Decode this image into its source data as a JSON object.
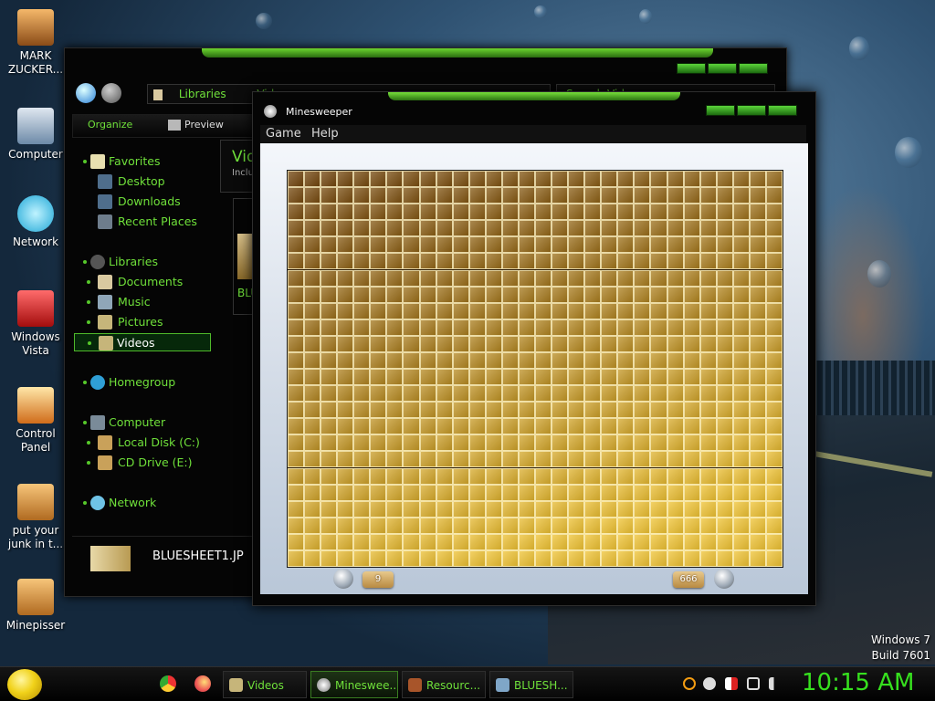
{
  "desktop": {
    "icons": [
      {
        "label": "MARK ZUCKER..."
      },
      {
        "label": "Computer"
      },
      {
        "label": "Network"
      },
      {
        "label": "Windows Vista"
      },
      {
        "label": "Control Panel"
      },
      {
        "label": "put your junk in t..."
      },
      {
        "label": "Minepisser"
      }
    ],
    "watermark_line1": "Windows 7",
    "watermark_line2": "Build 7601"
  },
  "explorer": {
    "address": {
      "part1": "Libraries",
      "part2": "Videos"
    },
    "search_placeholder": "Search Videos",
    "toolbar": {
      "organize": "Organize",
      "preview": "Preview"
    },
    "nav_tree": {
      "favorites": "Favorites",
      "desktop": "Desktop",
      "downloads": "Downloads",
      "recent_places": "Recent Places",
      "libraries": "Libraries",
      "documents": "Documents",
      "music": "Music",
      "pictures": "Pictures",
      "videos": "Videos",
      "homegroup": "Homegroup",
      "computer": "Computer",
      "local_disk": "Local Disk (C:)",
      "cd_drive": "CD Drive (E:)",
      "network": "Network"
    },
    "content_header_title": "Vid",
    "content_header_sub": "Inclu",
    "content_item_label": "BLU",
    "details_filename": "BLUESHEET1.JP"
  },
  "minesweeper": {
    "title": "Minesweeper",
    "menu": {
      "game": "Game",
      "help": "Help"
    },
    "timer_value": "9",
    "mines_value": "666",
    "board": {
      "columns": 30,
      "rows": 24,
      "state": "all covered"
    }
  },
  "taskbar": {
    "tasks": [
      {
        "label": "Videos"
      },
      {
        "label": "Minesweе..."
      },
      {
        "label": "Resourc..."
      },
      {
        "label": "BLUESH..."
      }
    ],
    "clock": "10:15 AM"
  }
}
